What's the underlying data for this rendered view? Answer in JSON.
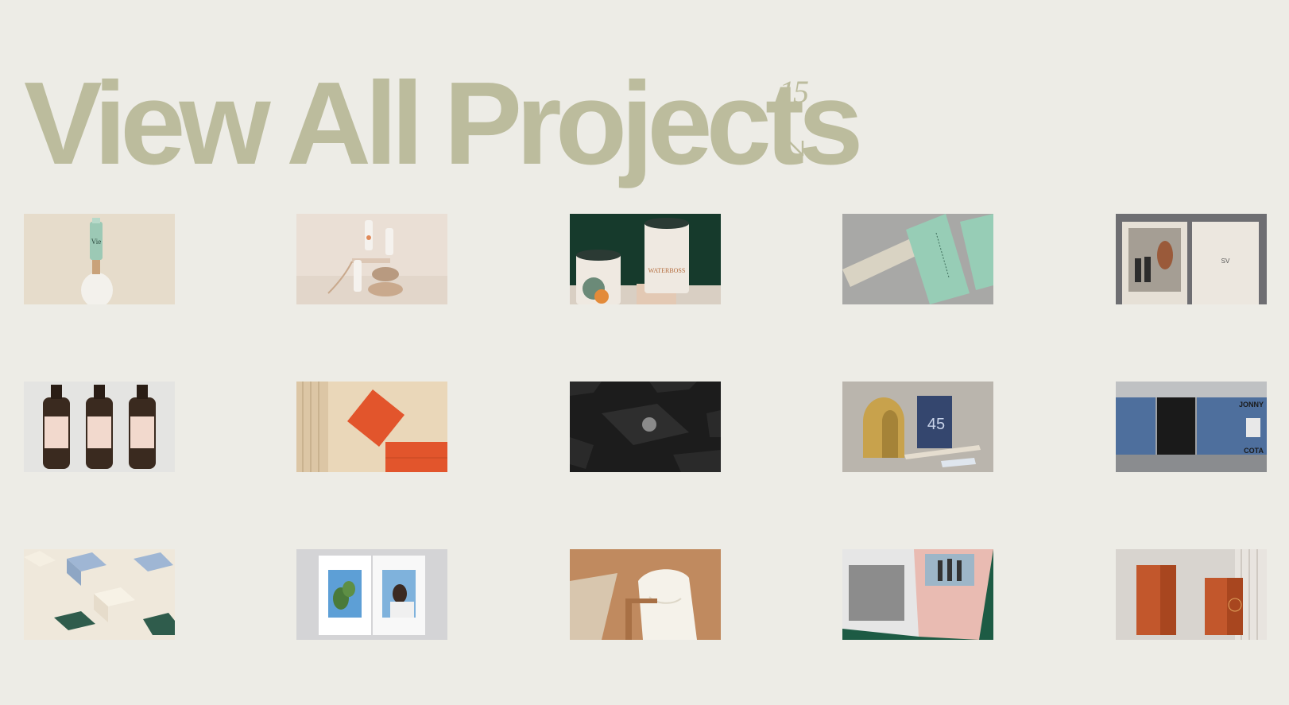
{
  "header": {
    "title": "View All Projects",
    "count": "15",
    "arrow_icon": "arrow-down-right-icon"
  },
  "colors": {
    "background": "#edece6",
    "title": "#bcbc9d"
  },
  "projects": [
    {
      "name": "project-vie-tube",
      "colors": [
        "#e6dccb",
        "#f3f1ec",
        "#9cc9b5"
      ]
    },
    {
      "name": "project-pink-bottles-stones",
      "colors": [
        "#eadfd5",
        "#f5f2ee",
        "#c9a98d"
      ]
    },
    {
      "name": "project-waterboss-canisters",
      "colors": [
        "#163a2c",
        "#efe9e1",
        "#e38b3a"
      ]
    },
    {
      "name": "project-mint-business-cards",
      "colors": [
        "#a8a8a6",
        "#97cdb6",
        "#d9d3c3"
      ]
    },
    {
      "name": "project-framed-product-print",
      "colors": [
        "#6e6e72",
        "#e6e0d6",
        "#2c2c2c"
      ]
    },
    {
      "name": "project-amber-bottles",
      "colors": [
        "#e4e4e2",
        "#3a2a1f",
        "#f2d9cd"
      ]
    },
    {
      "name": "project-orange-card-envelope",
      "colors": [
        "#ead7b9",
        "#e2552c",
        "#f3e6cf"
      ]
    },
    {
      "name": "project-black-boxes",
      "colors": [
        "#1c1c1c",
        "#2e2e2e",
        "#8a8a8a"
      ]
    },
    {
      "name": "project-gold-arch-booklet",
      "colors": [
        "#bab5ad",
        "#c8a24c",
        "#34466e"
      ]
    },
    {
      "name": "project-street-posters",
      "colors": [
        "#4e6f9d",
        "#1a1a1a",
        "#cfcfcf"
      ]
    },
    {
      "name": "project-pastel-boxes",
      "colors": [
        "#efe8db",
        "#9fb6d4",
        "#2f5c4c"
      ]
    },
    {
      "name": "project-magazine-spread",
      "colors": [
        "#d4d4d6",
        "#ffffff",
        "#5d9fd6"
      ]
    },
    {
      "name": "project-white-cloth-chair",
      "colors": [
        "#c08a5f",
        "#f5f2ea",
        "#a87045"
      ]
    },
    {
      "name": "project-pink-book-photo",
      "colors": [
        "#1d5b44",
        "#e9bbb2",
        "#8c8c8c"
      ]
    },
    {
      "name": "project-orange-boxes",
      "colors": [
        "#d8d4cf",
        "#c2572c",
        "#e8e4df"
      ]
    }
  ]
}
